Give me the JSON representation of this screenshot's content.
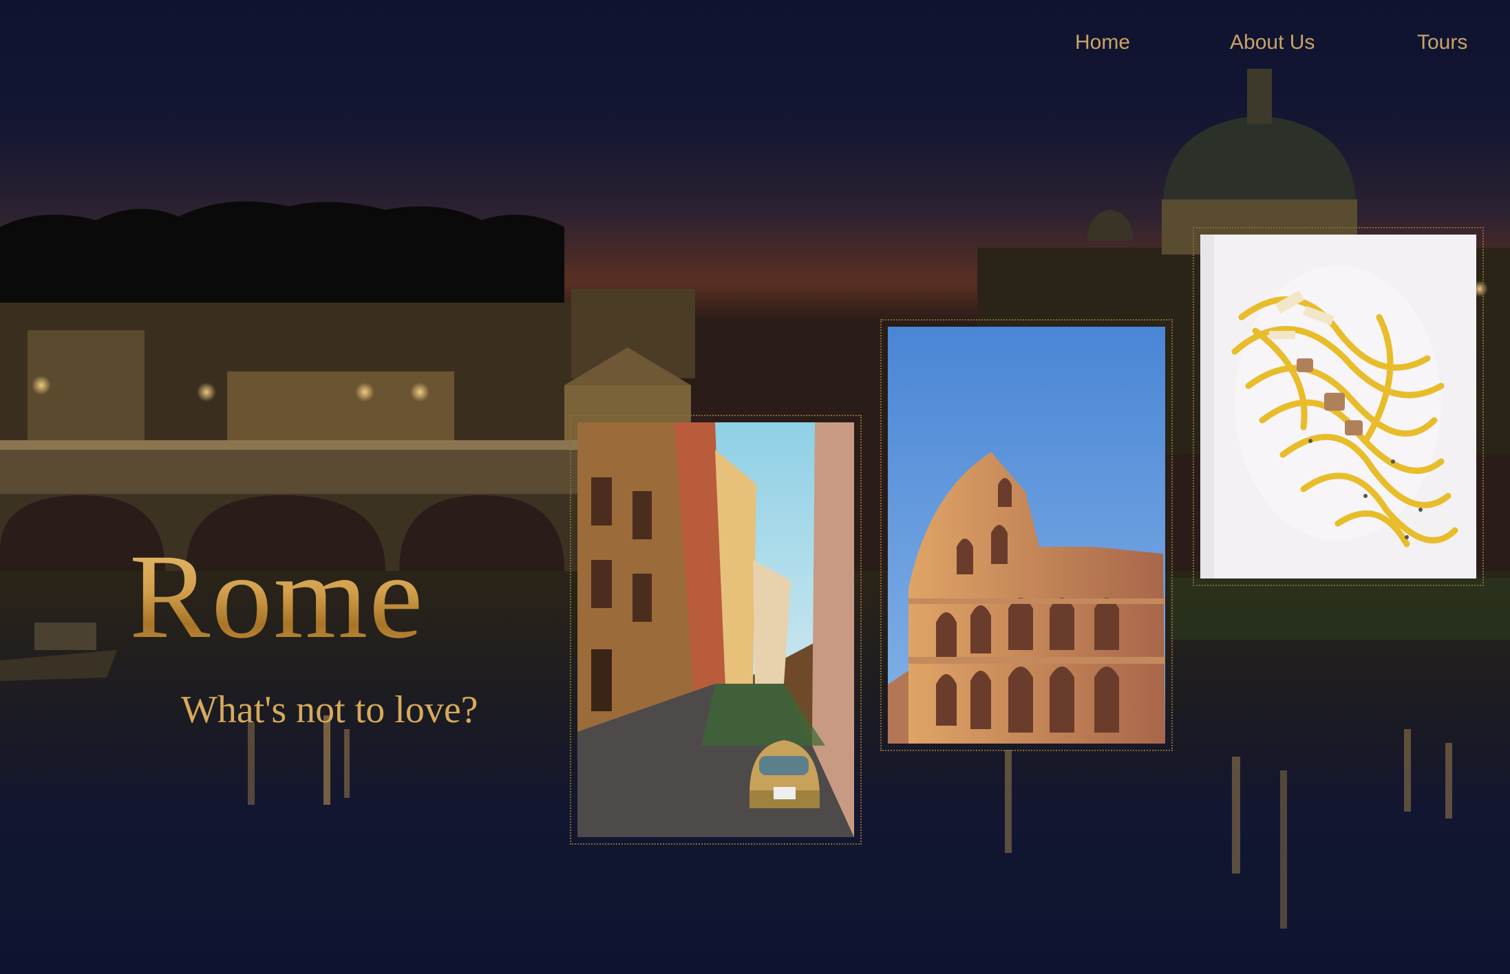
{
  "nav": {
    "home": "Home",
    "about": "About Us",
    "tours": "Tours"
  },
  "hero": {
    "title": "Rome",
    "tagline": "What's not to love?"
  },
  "colors": {
    "gold": "#c9a466",
    "night_sky": "#12142e",
    "sunset": "#5a2f22",
    "water": "#0e1428"
  },
  "gallery": [
    {
      "name": "street-photo",
      "subject": "narrow street with yellow classic car"
    },
    {
      "name": "colosseum-photo",
      "subject": "Colosseum under blue sky"
    },
    {
      "name": "pasta-photo",
      "subject": "plate of spaghetti carbonara"
    }
  ]
}
